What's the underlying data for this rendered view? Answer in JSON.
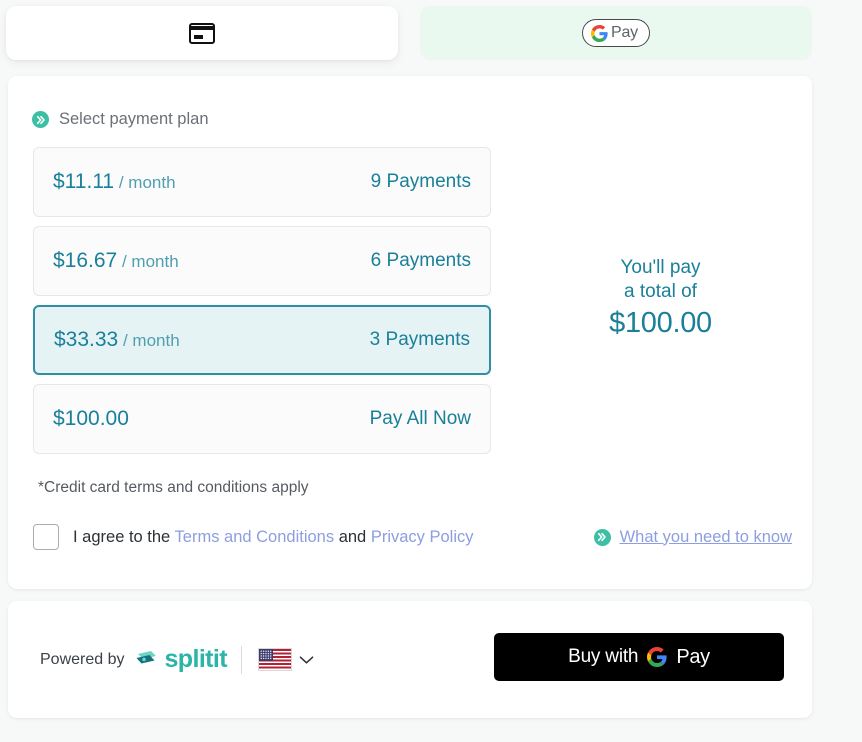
{
  "tabs": [
    {
      "id": "credit-card",
      "icon": "credit-card-icon",
      "label": "",
      "selected": false
    },
    {
      "id": "google-pay",
      "icon": "google-pay-icon",
      "label": "Pay",
      "selected": true
    }
  ],
  "section": {
    "icon": "double-chevron-icon",
    "title": "Select payment plan"
  },
  "plans": [
    {
      "amount": "$11.11",
      "period": " / month",
      "count": "9 Payments",
      "selected": false
    },
    {
      "amount": "$16.67",
      "period": " / month",
      "count": "6 Payments",
      "selected": false
    },
    {
      "amount": "$33.33",
      "period": " / month",
      "count": "3 Payments",
      "selected": true
    },
    {
      "amount": "$100.00",
      "period": "",
      "count": "Pay All Now",
      "selected": false
    }
  ],
  "total": {
    "line1": "You'll pay",
    "line2": "a total of",
    "amount": "$100.00"
  },
  "terms_note": "*Credit card terms and conditions apply",
  "agreement": {
    "checked": false,
    "prefix": "I agree to the ",
    "terms_link": "Terms and Conditions",
    "conjunction": " and ",
    "privacy_link": "Privacy Policy"
  },
  "need_to_know": {
    "icon": "double-chevron-icon",
    "label": "What you need to know"
  },
  "footer": {
    "powered_by": "Powered by",
    "brand": "splitit",
    "locale": {
      "flag": "us-flag-icon",
      "chevron": "chevron-down-icon"
    },
    "buy_button": {
      "prefix": "Buy with",
      "suffix": "Pay",
      "icon": "google-g-icon"
    }
  },
  "colors": {
    "page_bg": "#f7f8f8",
    "panel_bg": "#ffffff",
    "teal": "#1a8099",
    "accent_green": "#3cbfa5",
    "brand": "#2bb5a8",
    "link_blue": "#8d9ee0",
    "selected_border": "#2f8fa5",
    "selected_bg": "#e6f3f5",
    "gpay_tab_bg": "#eaf9f0",
    "button_bg": "#000000"
  }
}
